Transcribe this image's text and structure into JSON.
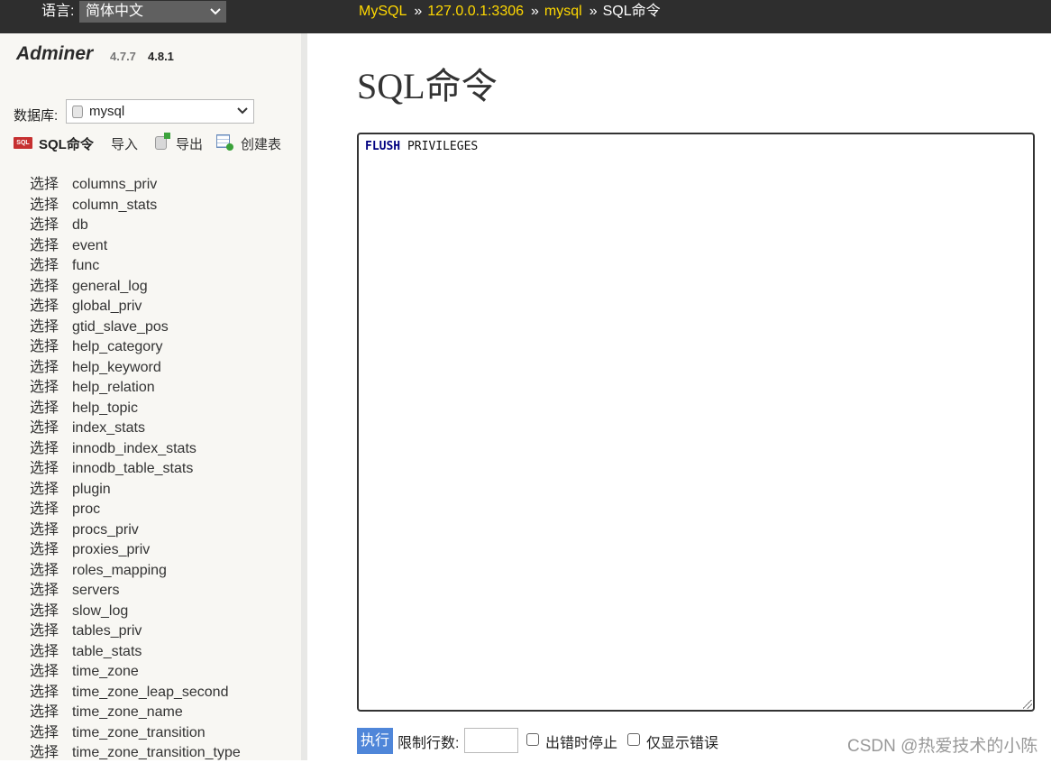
{
  "topbar": {
    "language_label": "语言:",
    "language_value": "简体中文",
    "breadcrumb": {
      "system": "MySQL",
      "server": "127.0.0.1:3306",
      "database": "mysql",
      "separator": "»",
      "current": "SQL命令"
    }
  },
  "sidebar": {
    "app_name": "Adminer",
    "version_old": "4.7.7",
    "version_new": "4.8.1",
    "db_label": "数据库:",
    "db_value": "mysql",
    "actions": {
      "sql": "SQL命令",
      "import": "导入",
      "export": "导出",
      "create_table": "创建表"
    },
    "select_label": "选择",
    "tables": [
      "columns_priv",
      "column_stats",
      "db",
      "event",
      "func",
      "general_log",
      "global_priv",
      "gtid_slave_pos",
      "help_category",
      "help_keyword",
      "help_relation",
      "help_topic",
      "index_stats",
      "innodb_index_stats",
      "innodb_table_stats",
      "plugin",
      "proc",
      "procs_priv",
      "proxies_priv",
      "roles_mapping",
      "servers",
      "slow_log",
      "tables_priv",
      "table_stats",
      "time_zone",
      "time_zone_leap_second",
      "time_zone_name",
      "time_zone_transition",
      "time_zone_transition_type"
    ]
  },
  "main": {
    "title": "SQL命令",
    "sql_keyword": "FLUSH",
    "sql_rest": " PRIVILEGES",
    "execute_label": "执行",
    "limit_label": "限制行数:",
    "limit_value": "",
    "stop_on_error_label": "出错时停止",
    "only_errors_label": "仅显示错误"
  },
  "watermark": "CSDN @热爱技术的小陈"
}
